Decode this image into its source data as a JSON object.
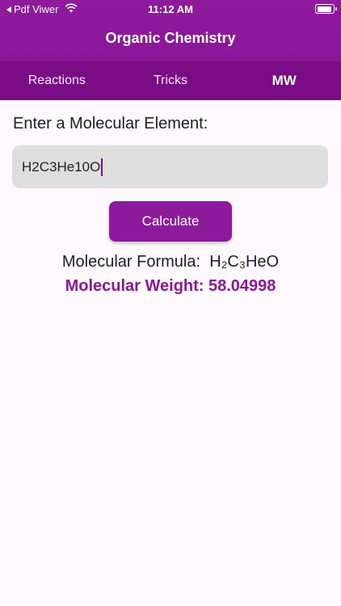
{
  "status_bar": {
    "back_app": "Pdf Viwer",
    "time": "11:12 AM"
  },
  "app_title": "Organic Chemistry",
  "tabs": [
    {
      "label": "Reactions"
    },
    {
      "label": "Tricks"
    },
    {
      "label": "MW"
    }
  ],
  "active_tab": "MW",
  "prompt": "Enter a Molecular Element:",
  "input": {
    "value": "H2C3He10O"
  },
  "calculate_label": "Calculate",
  "result": {
    "formula_label": "Molecular Formula:",
    "formula_value": "H₂C₃HeO",
    "weight_text": "Molecular Weight: 58.04998"
  },
  "colors": {
    "primary": "#8c1898",
    "tab_bar": "#7a0d86",
    "input_bg": "#dedede"
  }
}
